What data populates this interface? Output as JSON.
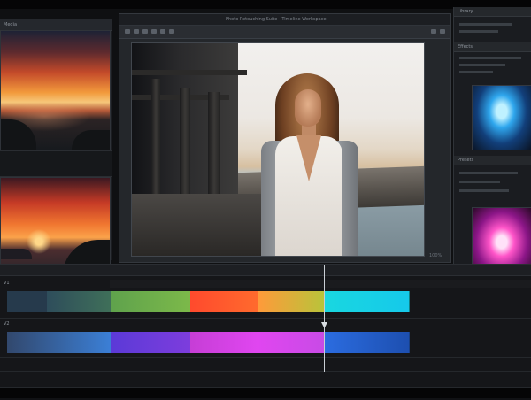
{
  "window": {
    "title": "Photo Retouching Suite - Timeline Workspace",
    "badge": "●●●"
  },
  "left_bin": {
    "title": "Media",
    "items": [
      {
        "name": "sunset coast thumbnail"
      },
      {
        "name": "sunset lake thumbnail"
      }
    ]
  },
  "viewer": {
    "title": "Photo Retouching Suite - Timeline Workspace",
    "zoom": "100%"
  },
  "right_panel": {
    "headers": [
      "Library",
      "Effects",
      "Presets"
    ]
  },
  "timeline": {
    "track1_label": "V1",
    "track2_label": "V2",
    "clips_row1": [
      "#263a4c",
      "#3f6f59",
      "#7cb94a",
      "#ff4a2d",
      "#ff9a3a",
      "#19d7e0"
    ],
    "clips_row2": [
      "#3b7fd6",
      "#5b3ad7",
      "#c63ed6",
      "#e046f0",
      "#2b6ce0"
    ]
  },
  "colors": {
    "accent": "#2b6ce0",
    "background": "#0f1012",
    "panel": "#1b1d21"
  }
}
